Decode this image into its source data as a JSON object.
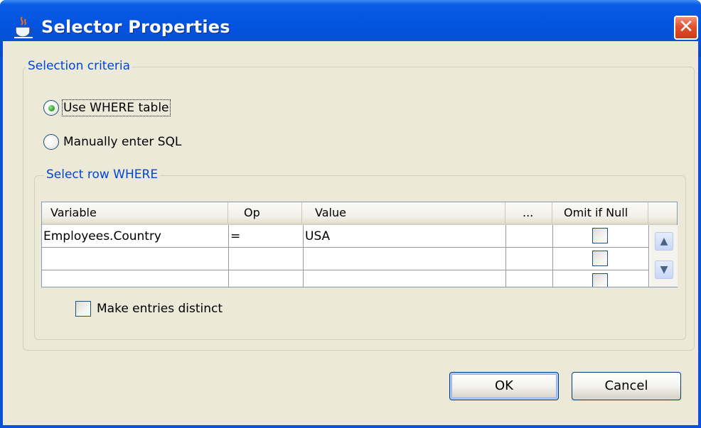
{
  "window": {
    "title": "Selector Properties",
    "close_glyph": "✕"
  },
  "selection_criteria": {
    "label": "Selection criteria",
    "use_where_label": "Use WHERE table",
    "manual_sql_label": "Manually enter SQL",
    "selected": "use_where"
  },
  "where_group": {
    "label": "Select row WHERE",
    "columns": [
      "Variable",
      "Op",
      "Value",
      "...",
      "Omit if Null"
    ],
    "rows": [
      {
        "variable": "Employees.Country",
        "op": "=",
        "value": "USA",
        "dots": "",
        "omit_if_null": false
      },
      {
        "variable": "",
        "op": "",
        "value": "",
        "dots": "",
        "omit_if_null": false
      },
      {
        "variable": "",
        "op": "",
        "value": "",
        "dots": "",
        "omit_if_null": false
      }
    ],
    "distinct_label": "Make entries distinct",
    "distinct_checked": false
  },
  "buttons": {
    "ok": "OK",
    "cancel": "Cancel"
  },
  "colors": {
    "group_label": "#0046d5",
    "client_bg": "#ece9d8",
    "titlebar": "#0254e0"
  },
  "icons": {
    "title": "java-coffee-cup-icon",
    "scroll_up": "chevron-up-icon",
    "scroll_down": "chevron-down-icon"
  }
}
